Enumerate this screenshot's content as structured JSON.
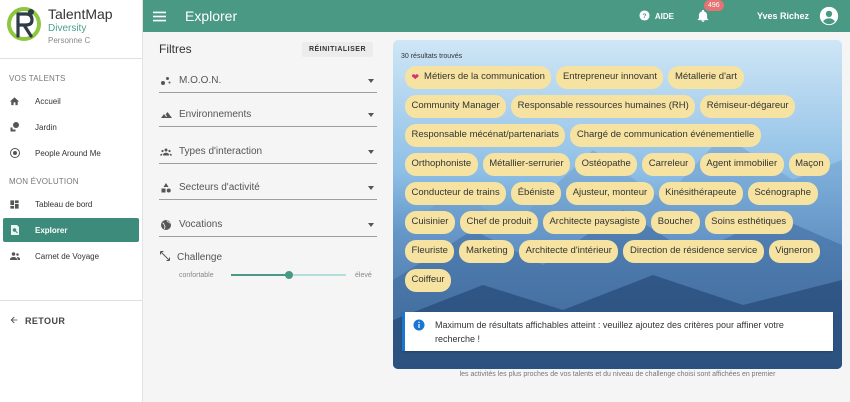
{
  "brand": {
    "title": "TalentMap",
    "subtitle": "Diversity",
    "user": "Personne C"
  },
  "sidebar": {
    "section1": "VOS TALENTS",
    "items1": [
      {
        "label": "Accueil",
        "icon": "home-icon"
      },
      {
        "label": "Jardin",
        "icon": "tree-icon"
      },
      {
        "label": "People Around Me",
        "icon": "radio-target-icon"
      }
    ],
    "section2": "MON ÉVOLUTION",
    "items2": [
      {
        "label": "Tableau de bord",
        "icon": "dashboard-icon"
      },
      {
        "label": "Explorer",
        "icon": "search-page-icon",
        "active": true
      },
      {
        "label": "Carnet de Voyage",
        "icon": "people-icon"
      }
    ],
    "back_label": "RETOUR"
  },
  "header": {
    "title": "Explorer",
    "help_label": "AIDE",
    "notification_count": "496",
    "user_name": "Yves Richez"
  },
  "filters": {
    "title": "Filtres",
    "reset_label": "RÉINITIALISER",
    "items": [
      {
        "label": "M.O.O.N.",
        "icon": "shapes-icon"
      },
      {
        "label": "Environnements",
        "icon": "landscape-icon"
      },
      {
        "label": "Types d'interaction",
        "icon": "groups-icon"
      },
      {
        "label": "Secteurs d'activité",
        "icon": "category-icon"
      },
      {
        "label": "Vocations",
        "icon": "globe-icon"
      }
    ],
    "challenge": {
      "label": "Challenge",
      "min_label": "confortable",
      "max_label": "élevé",
      "value": 0.5
    }
  },
  "results": {
    "count_text": "30 résultats trouvés",
    "chips": [
      {
        "label": "Métiers de la communication",
        "favorite": true
      },
      {
        "label": "Entrepreneur innovant"
      },
      {
        "label": "Métallerie d'art"
      },
      {
        "label": "Community Manager"
      },
      {
        "label": "Responsable ressources humaines (RH)"
      },
      {
        "label": "Rémiseur-dégareur"
      },
      {
        "label": "Responsable mécénat/partenariats"
      },
      {
        "label": "Chargé de communication événementielle"
      },
      {
        "label": "Orthophoniste"
      },
      {
        "label": "Métallier-serrurier"
      },
      {
        "label": "Ostéopathe"
      },
      {
        "label": "Carreleur"
      },
      {
        "label": "Agent immobilier"
      },
      {
        "label": "Maçon"
      },
      {
        "label": "Conducteur de trains"
      },
      {
        "label": "Ébéniste"
      },
      {
        "label": "Ajusteur, monteur"
      },
      {
        "label": "Kinésithérapeute"
      },
      {
        "label": "Scénographe"
      },
      {
        "label": "Cuisinier"
      },
      {
        "label": "Chef de produit"
      },
      {
        "label": "Architecte paysagiste"
      },
      {
        "label": "Boucher"
      },
      {
        "label": "Soins esthétiques"
      },
      {
        "label": "Fleuriste"
      },
      {
        "label": "Marketing"
      },
      {
        "label": "Architecte d'intérieur"
      },
      {
        "label": "Direction de résidence service"
      },
      {
        "label": "Vigneron"
      },
      {
        "label": "Coiffeur"
      }
    ],
    "alert_text": "Maximum de résultats affichables atteint : veuillez ajoutez des critères pour affiner votre recherche !",
    "footnote": "les activités les plus proches de vos talents et du niveau de challenge choisi sont affichées en premier"
  },
  "colors": {
    "primary": "#4a9985",
    "active": "#3d8b7a",
    "chip": "#f6e3a1",
    "badge": "#e57373",
    "info": "#1976d2"
  }
}
